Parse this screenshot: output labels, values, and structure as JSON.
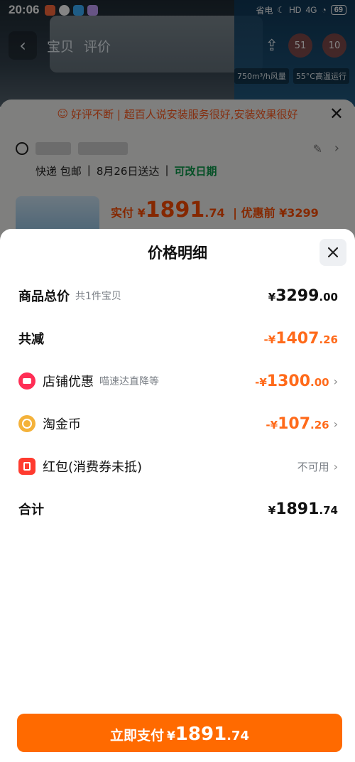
{
  "status_bar": {
    "time": "20:06",
    "save_mode": "省电",
    "hd": "HD",
    "network": "4G",
    "battery": "69"
  },
  "nav": {
    "back_icon": "chevron-left-icon",
    "tabs": [
      "宝贝",
      "评价"
    ],
    "badges": [
      "51",
      "10"
    ]
  },
  "specs": [
    "750m³/h风量",
    "55°C高温运行"
  ],
  "promo": {
    "text": "好评不断 | 超百人说安装服务很好,安装效果很好",
    "close_icon": "close-icon"
  },
  "address": {
    "delivery": [
      "快递 包邮",
      "8月26日送达"
    ],
    "change_date": "可改日期"
  },
  "product": {
    "paid_label": "实付",
    "currency": "¥",
    "price_int": "1891",
    "price_dec": ".74",
    "before_label": "| 优惠前 ¥3299"
  },
  "sheet": {
    "title": "价格明细",
    "close_icon": "close-icon",
    "rows": [
      {
        "label": "商品总价",
        "sub": "共1件宝贝",
        "yen": "¥",
        "int": "3299",
        "dec": ".00"
      },
      {
        "label": "共减",
        "yen": "-¥",
        "int": "1407",
        "dec": ".26"
      },
      {
        "label": "店铺优惠",
        "sub": "喵速达直降等",
        "yen": "-¥",
        "int": "1300",
        "dec": ".00",
        "icon": "store-icon"
      },
      {
        "label": "淘金币",
        "yen": "-¥",
        "int": "107",
        "dec": ".26",
        "icon": "coin-icon"
      },
      {
        "label": "红包(消费券未抵)",
        "value": "不可用",
        "icon": "red-packet-icon"
      },
      {
        "label": "合计",
        "yen": "¥",
        "int": "1891",
        "dec": ".74"
      }
    ],
    "pay_button": {
      "label": "立即支付",
      "yen": "¥",
      "int": "1891",
      "dec": ".74"
    }
  },
  "colors": {
    "accent": "#ff6a00",
    "discount": "#ff6a1a",
    "muted": "#7a7f86",
    "green": "#0a9a4a"
  }
}
